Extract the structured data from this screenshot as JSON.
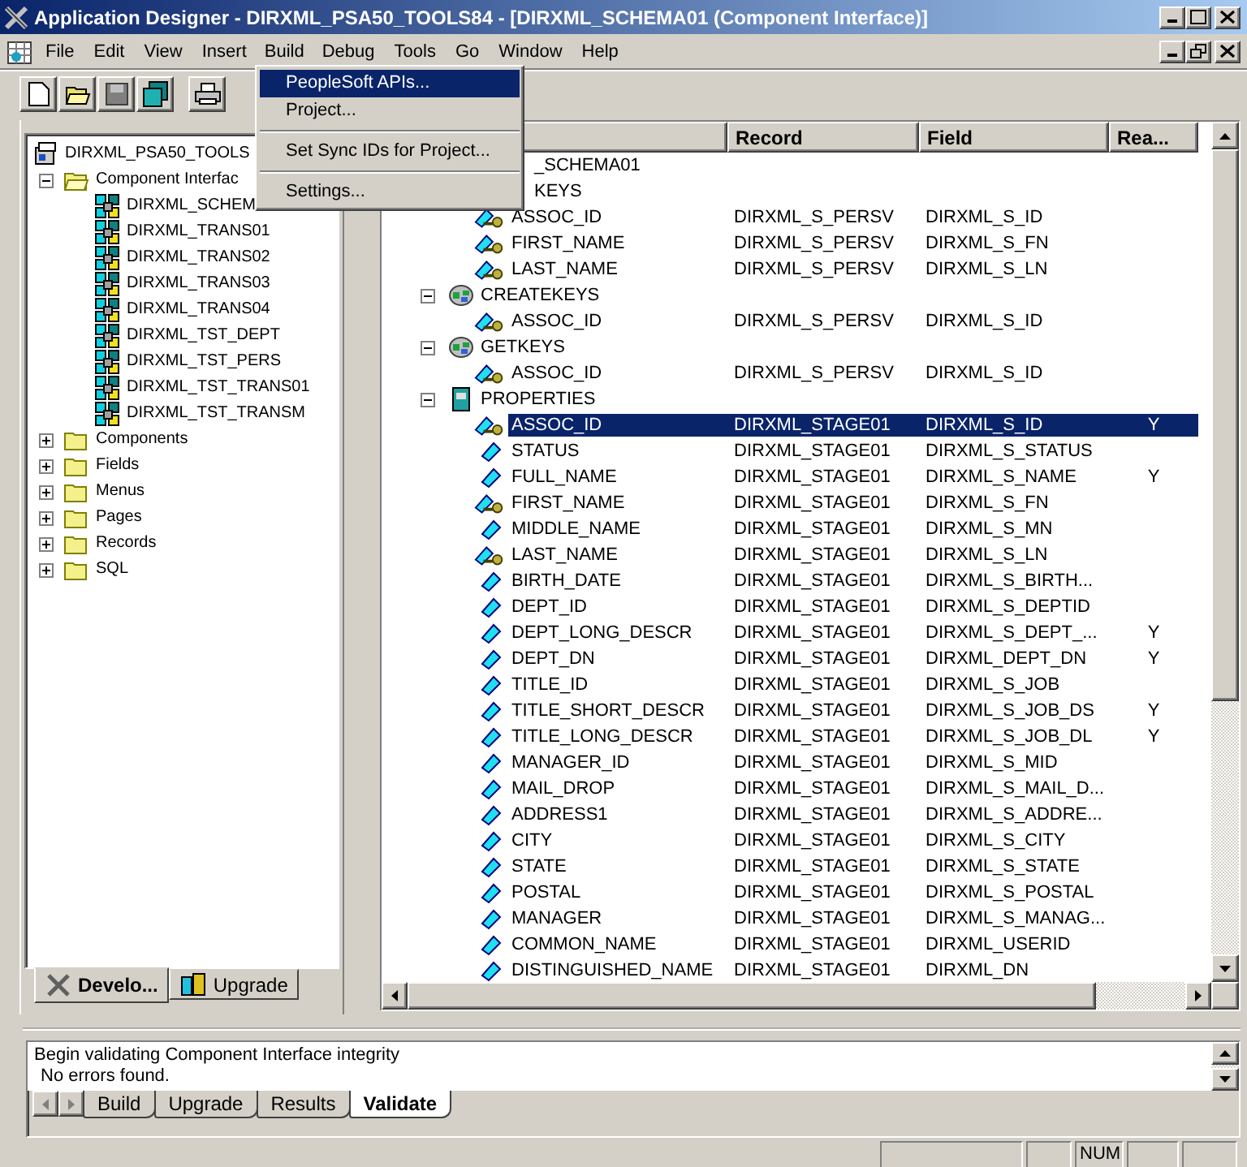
{
  "window": {
    "title": "Application Designer - DIRXML_PSA50_TOOLS84 - [DIRXML_SCHEMA01 (Component Interface)]"
  },
  "menu": [
    {
      "label": "File",
      "selected": false
    },
    {
      "label": "Edit",
      "selected": false
    },
    {
      "label": "View",
      "selected": false
    },
    {
      "label": "Insert",
      "selected": false
    },
    {
      "label": "Build",
      "selected": true
    },
    {
      "label": "Debug",
      "selected": false
    },
    {
      "label": "Tools",
      "selected": false
    },
    {
      "label": "Go",
      "selected": false
    },
    {
      "label": "Window",
      "selected": false
    },
    {
      "label": "Help",
      "selected": false
    }
  ],
  "build_menu": {
    "items": [
      {
        "kind": "item",
        "label": "PeopleSoft APIs...",
        "selected": true
      },
      {
        "kind": "item",
        "label": "Project...",
        "selected": false
      },
      {
        "kind": "separator"
      },
      {
        "kind": "item",
        "label": "Set Sync IDs for Project...",
        "selected": false
      },
      {
        "kind": "separator"
      },
      {
        "kind": "item",
        "label": "Settings...",
        "selected": false
      }
    ]
  },
  "project_tree": {
    "label": "DIRXML_PSA50_TOOLS",
    "children": [
      {
        "label": "Component Interfac",
        "kind": "folder",
        "expanded": true,
        "children": [
          {
            "label": "DIRXML_SCHEM",
            "kind": "component"
          },
          {
            "label": "DIRXML_TRANS01",
            "kind": "component"
          },
          {
            "label": "DIRXML_TRANS02",
            "kind": "component"
          },
          {
            "label": "DIRXML_TRANS03",
            "kind": "component"
          },
          {
            "label": "DIRXML_TRANS04",
            "kind": "component"
          },
          {
            "label": "DIRXML_TST_DEPT",
            "kind": "component"
          },
          {
            "label": "DIRXML_TST_PERS",
            "kind": "component"
          },
          {
            "label": "DIRXML_TST_TRANS01",
            "kind": "component"
          },
          {
            "label": "DIRXML_TST_TRANSM",
            "kind": "component"
          }
        ]
      },
      {
        "label": "Components",
        "kind": "folder",
        "expanded": false
      },
      {
        "label": "Fields",
        "kind": "folder",
        "expanded": false
      },
      {
        "label": "Menus",
        "kind": "folder",
        "expanded": false
      },
      {
        "label": "Pages",
        "kind": "folder",
        "expanded": false
      },
      {
        "label": "Records",
        "kind": "folder",
        "expanded": false
      },
      {
        "label": "SQL",
        "kind": "folder",
        "expanded": false
      }
    ]
  },
  "project_tabs": [
    {
      "label": "Develo...",
      "selected": true
    },
    {
      "label": "Upgrade",
      "selected": false
    }
  ],
  "definition": {
    "columns": [
      "Record",
      "Field",
      "Rea..."
    ],
    "rows": [
      {
        "name": "_SCHEMA01",
        "covered": true,
        "selected": false,
        "children": [
          {
            "name": "KEYS",
            "covered": true,
            "selected": false,
            "children": [
              {
                "name": "ASSOC_ID",
                "kind": "key_field",
                "record": "DIRXML_S_PERSV",
                "field": "DIRXML_S_ID",
                "selected": false
              },
              {
                "name": "FIRST_NAME",
                "kind": "key_field",
                "record": "DIRXML_S_PERSV",
                "field": "DIRXML_S_FN",
                "selected": false
              },
              {
                "name": "LAST_NAME",
                "kind": "key_field",
                "record": "DIRXML_S_PERSV",
                "field": "DIRXML_S_LN",
                "selected": false
              }
            ]
          },
          {
            "name": "CREATEKEYS",
            "kind": "keygroup",
            "expanded": true,
            "selected": false,
            "children": [
              {
                "name": "ASSOC_ID",
                "kind": "key_field",
                "record": "DIRXML_S_PERSV",
                "field": "DIRXML_S_ID",
                "selected": false
              }
            ]
          },
          {
            "name": "GETKEYS",
            "kind": "keygroup",
            "expanded": true,
            "selected": false,
            "children": [
              {
                "name": "ASSOC_ID",
                "kind": "key_field",
                "record": "DIRXML_S_PERSV",
                "field": "DIRXML_S_ID",
                "selected": false
              }
            ]
          },
          {
            "name": "PROPERTIES",
            "kind": "properties",
            "expanded": true,
            "selected": false,
            "children": [
              {
                "name": "ASSOC_ID",
                "kind": "key_field",
                "record": "DIRXML_STAGE01",
                "field": "DIRXML_S_ID",
                "read": "Y",
                "selected": true
              },
              {
                "name": "STATUS",
                "kind": "field",
                "record": "DIRXML_STAGE01",
                "field": "DIRXML_S_STATUS",
                "selected": false
              },
              {
                "name": "FULL_NAME",
                "kind": "field",
                "record": "DIRXML_STAGE01",
                "field": "DIRXML_S_NAME",
                "read": "Y",
                "selected": false
              },
              {
                "name": "FIRST_NAME",
                "kind": "key_field",
                "record": "DIRXML_STAGE01",
                "field": "DIRXML_S_FN",
                "selected": false
              },
              {
                "name": "MIDDLE_NAME",
                "kind": "field",
                "record": "DIRXML_STAGE01",
                "field": "DIRXML_S_MN",
                "selected": false
              },
              {
                "name": "LAST_NAME",
                "kind": "key_field",
                "record": "DIRXML_STAGE01",
                "field": "DIRXML_S_LN",
                "selected": false
              },
              {
                "name": "BIRTH_DATE",
                "kind": "field",
                "record": "DIRXML_STAGE01",
                "field": "DIRXML_S_BIRTH...",
                "selected": false
              },
              {
                "name": "DEPT_ID",
                "kind": "field",
                "record": "DIRXML_STAGE01",
                "field": "DIRXML_S_DEPTID",
                "selected": false
              },
              {
                "name": "DEPT_LONG_DESCR",
                "kind": "field",
                "record": "DIRXML_STAGE01",
                "field": "DIRXML_S_DEPT_...",
                "read": "Y",
                "selected": false
              },
              {
                "name": "DEPT_DN",
                "kind": "field",
                "record": "DIRXML_STAGE01",
                "field": "DIRXML_DEPT_DN",
                "read": "Y",
                "selected": false
              },
              {
                "name": "TITLE_ID",
                "kind": "field",
                "record": "DIRXML_STAGE01",
                "field": "DIRXML_S_JOB",
                "selected": false
              },
              {
                "name": "TITLE_SHORT_DESCR",
                "kind": "field",
                "record": "DIRXML_STAGE01",
                "field": "DIRXML_S_JOB_DS",
                "read": "Y",
                "selected": false
              },
              {
                "name": "TITLE_LONG_DESCR",
                "kind": "field",
                "record": "DIRXML_STAGE01",
                "field": "DIRXML_S_JOB_DL",
                "read": "Y",
                "selected": false
              },
              {
                "name": "MANAGER_ID",
                "kind": "field",
                "record": "DIRXML_STAGE01",
                "field": "DIRXML_S_MID",
                "selected": false
              },
              {
                "name": "MAIL_DROP",
                "kind": "field",
                "record": "DIRXML_STAGE01",
                "field": "DIRXML_S_MAIL_D...",
                "selected": false
              },
              {
                "name": "ADDRESS1",
                "kind": "field",
                "record": "DIRXML_STAGE01",
                "field": "DIRXML_S_ADDRE...",
                "selected": false
              },
              {
                "name": "CITY",
                "kind": "field",
                "record": "DIRXML_STAGE01",
                "field": "DIRXML_S_CITY",
                "selected": false
              },
              {
                "name": "STATE",
                "kind": "field",
                "record": "DIRXML_STAGE01",
                "field": "DIRXML_S_STATE",
                "selected": false
              },
              {
                "name": "POSTAL",
                "kind": "field",
                "record": "DIRXML_STAGE01",
                "field": "DIRXML_S_POSTAL",
                "selected": false
              },
              {
                "name": "MANAGER",
                "kind": "field",
                "record": "DIRXML_STAGE01",
                "field": "DIRXML_S_MANAG...",
                "selected": false
              },
              {
                "name": "COMMON_NAME",
                "kind": "field",
                "record": "DIRXML_STAGE01",
                "field": "DIRXML_USERID",
                "selected": false
              },
              {
                "name": "DISTINGUISHED_NAME",
                "kind": "field",
                "record": "DIRXML_STAGE01",
                "field": "DIRXML_DN",
                "selected": false
              }
            ]
          }
        ]
      }
    ]
  },
  "output": {
    "lines": [
      "Begin validating Component Interface integrity",
      "No errors found."
    ],
    "tabs": [
      {
        "label": "Build",
        "selected": false
      },
      {
        "label": "Upgrade",
        "selected": false
      },
      {
        "label": "Results",
        "selected": false
      },
      {
        "label": "Validate",
        "selected": true
      }
    ]
  },
  "status_bar": {
    "indicator": "NUM"
  }
}
